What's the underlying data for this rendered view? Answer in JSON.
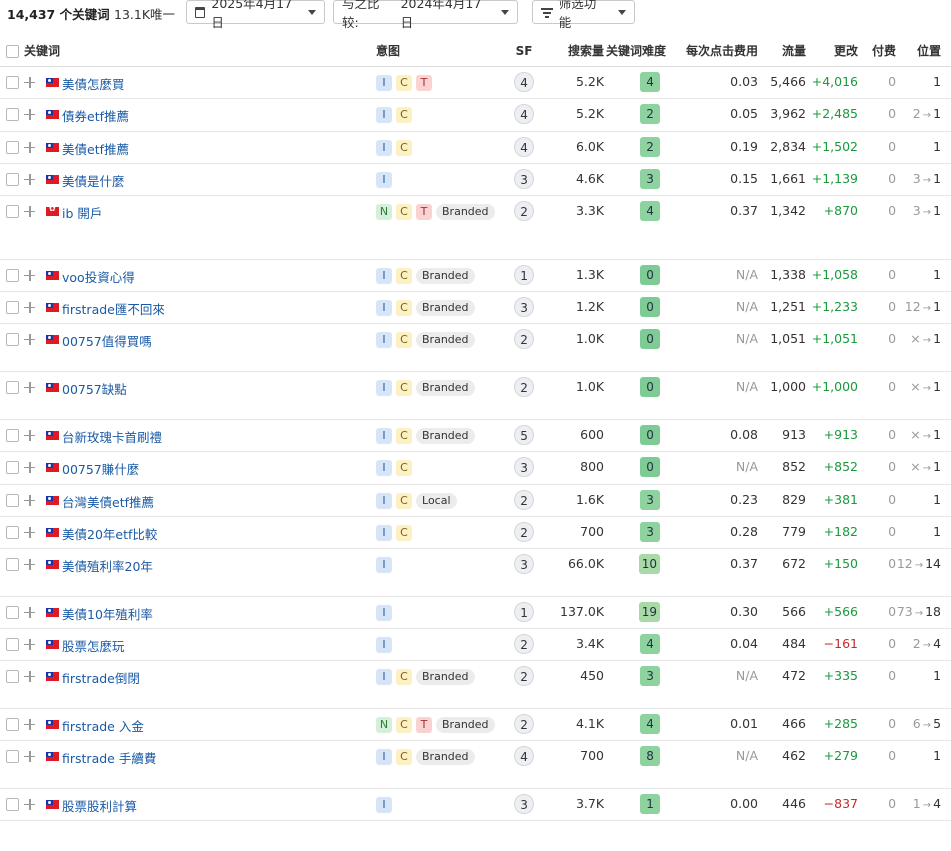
{
  "topbar": {
    "keyword_count": "14,437 个关键词",
    "unique": "13.1K唯一",
    "date": "2025年4月17日",
    "compare_label": "与之比较:",
    "compare_date": "2024年4月17日",
    "filter_label": "筛选功能"
  },
  "columns": {
    "keyword": "关键词",
    "intent": "意图",
    "sf": "SF",
    "volume": "搜索量",
    "kd": "关键词难度",
    "cpc": "每次点击费用",
    "traffic": "流量",
    "change": "更改",
    "paid": "付费",
    "position": "位置"
  },
  "rows": [
    {
      "flag": "tw",
      "keyword": "美債怎麼買",
      "intents": [
        "I",
        "C",
        "T"
      ],
      "tag": "",
      "sf": "4",
      "volume": "5.2K",
      "kd": "4",
      "cpc": "0.03",
      "traffic": "5,466",
      "change": "+4,016",
      "sign": "pos",
      "paid": "0",
      "pos_from": "",
      "pos_arrow": "",
      "pos_to": "1",
      "height": 32
    },
    {
      "flag": "tw",
      "keyword": "債券etf推薦",
      "intents": [
        "I",
        "C"
      ],
      "tag": "",
      "sf": "4",
      "volume": "5.2K",
      "kd": "2",
      "cpc": "0.05",
      "traffic": "3,962",
      "change": "+2,485",
      "sign": "pos",
      "paid": "0",
      "pos_from": "2",
      "pos_arrow": "→",
      "pos_to": "1",
      "height": 33
    },
    {
      "flag": "tw",
      "keyword": "美債etf推薦",
      "intents": [
        "I",
        "C"
      ],
      "tag": "",
      "sf": "4",
      "volume": "6.0K",
      "kd": "2",
      "cpc": "0.19",
      "traffic": "2,834",
      "change": "+1,502",
      "sign": "pos",
      "paid": "0",
      "pos_from": "",
      "pos_arrow": "",
      "pos_to": "1",
      "height": 32
    },
    {
      "flag": "tw",
      "keyword": "美債是什麼",
      "intents": [
        "I"
      ],
      "tag": "",
      "sf": "3",
      "volume": "4.6K",
      "kd": "3",
      "cpc": "0.15",
      "traffic": "1,661",
      "change": "+1,139",
      "sign": "pos",
      "paid": "0",
      "pos_from": "3",
      "pos_arrow": "→",
      "pos_to": "1",
      "height": 32
    },
    {
      "flag": "hk",
      "keyword": "ib 開戶",
      "intents": [
        "N",
        "C",
        "T"
      ],
      "tag": "Branded",
      "sf": "2",
      "volume": "3.3K",
      "kd": "4",
      "cpc": "0.37",
      "traffic": "1,342",
      "change": "+870",
      "sign": "pos",
      "paid": "0",
      "pos_from": "3",
      "pos_arrow": "→",
      "pos_to": "1",
      "height": 64
    },
    {
      "flag": "tw",
      "keyword": "voo投資心得",
      "intents": [
        "I",
        "C"
      ],
      "tag": "Branded",
      "sf": "1",
      "volume": "1.3K",
      "kd": "0",
      "cpc": "N/A",
      "traffic": "1,338",
      "change": "+1,058",
      "sign": "pos",
      "paid": "0",
      "pos_from": "",
      "pos_arrow": "",
      "pos_to": "1",
      "height": 32
    },
    {
      "flag": "tw",
      "keyword": "firstrade匯不回來",
      "intents": [
        "I",
        "C"
      ],
      "tag": "Branded",
      "sf": "3",
      "volume": "1.2K",
      "kd": "0",
      "cpc": "N/A",
      "traffic": "1,251",
      "change": "+1,233",
      "sign": "pos",
      "paid": "0",
      "pos_from": "12",
      "pos_arrow": "→",
      "pos_to": "1",
      "height": 32
    },
    {
      "flag": "tw",
      "keyword": "00757值得買嗎",
      "intents": [
        "I",
        "C"
      ],
      "tag": "Branded",
      "sf": "2",
      "volume": "1.0K",
      "kd": "0",
      "cpc": "N/A",
      "traffic": "1,051",
      "change": "+1,051",
      "sign": "pos",
      "paid": "0",
      "pos_from": "×",
      "pos_arrow": "→",
      "pos_to": "1",
      "height": 48
    },
    {
      "flag": "tw",
      "keyword": "00757缺點",
      "intents": [
        "I",
        "C"
      ],
      "tag": "Branded",
      "sf": "2",
      "volume": "1.0K",
      "kd": "0",
      "cpc": "N/A",
      "traffic": "1,000",
      "change": "+1,000",
      "sign": "pos",
      "paid": "0",
      "pos_from": "×",
      "pos_arrow": "→",
      "pos_to": "1",
      "height": 48
    },
    {
      "flag": "tw",
      "keyword": "台新玫瑰卡首刷禮",
      "intents": [
        "I",
        "C"
      ],
      "tag": "Branded",
      "sf": "5",
      "volume": "600",
      "kd": "0",
      "cpc": "0.08",
      "traffic": "913",
      "change": "+913",
      "sign": "pos",
      "paid": "0",
      "pos_from": "×",
      "pos_arrow": "→",
      "pos_to": "1",
      "height": 32
    },
    {
      "flag": "tw",
      "keyword": "00757賺什麼",
      "intents": [
        "I",
        "C"
      ],
      "tag": "",
      "sf": "3",
      "volume": "800",
      "kd": "0",
      "cpc": "N/A",
      "traffic": "852",
      "change": "+852",
      "sign": "pos",
      "paid": "0",
      "pos_from": "×",
      "pos_arrow": "→",
      "pos_to": "1",
      "height": 33
    },
    {
      "flag": "tw",
      "keyword": "台灣美債etf推薦",
      "intents": [
        "I",
        "C"
      ],
      "tag": "Local",
      "sf": "2",
      "volume": "1.6K",
      "kd": "3",
      "cpc": "0.23",
      "traffic": "829",
      "change": "+381",
      "sign": "pos",
      "paid": "0",
      "pos_from": "",
      "pos_arrow": "",
      "pos_to": "1",
      "height": 32
    },
    {
      "flag": "tw",
      "keyword": "美債20年etf比較",
      "intents": [
        "I",
        "C"
      ],
      "tag": "",
      "sf": "2",
      "volume": "700",
      "kd": "3",
      "cpc": "0.28",
      "traffic": "779",
      "change": "+182",
      "sign": "pos",
      "paid": "0",
      "pos_from": "",
      "pos_arrow": "",
      "pos_to": "1",
      "height": 32
    },
    {
      "flag": "tw",
      "keyword": "美債殖利率20年",
      "intents": [
        "I"
      ],
      "tag": "",
      "sf": "3",
      "volume": "66.0K",
      "kd": "10",
      "cpc": "0.37",
      "traffic": "672",
      "change": "+150",
      "sign": "pos",
      "paid": "0",
      "pos_from": "12",
      "pos_arrow": "→",
      "pos_to": "14",
      "height": 48
    },
    {
      "flag": "tw",
      "keyword": "美債10年殖利率",
      "intents": [
        "I"
      ],
      "tag": "",
      "sf": "1",
      "volume": "137.0K",
      "kd": "19",
      "cpc": "0.30",
      "traffic": "566",
      "change": "+566",
      "sign": "pos",
      "paid": "0",
      "pos_from": "73",
      "pos_arrow": "→",
      "pos_to": "18",
      "height": 32
    },
    {
      "flag": "tw",
      "keyword": "股票怎麼玩",
      "intents": [
        "I"
      ],
      "tag": "",
      "sf": "2",
      "volume": "3.4K",
      "kd": "4",
      "cpc": "0.04",
      "traffic": "484",
      "change": "−161",
      "sign": "neg",
      "paid": "0",
      "pos_from": "2",
      "pos_arrow": "→",
      "pos_to": "4",
      "height": 32
    },
    {
      "flag": "tw",
      "keyword": "firstrade倒閉",
      "intents": [
        "I",
        "C"
      ],
      "tag": "Branded",
      "sf": "2",
      "volume": "450",
      "kd": "3",
      "cpc": "N/A",
      "traffic": "472",
      "change": "+335",
      "sign": "pos",
      "paid": "0",
      "pos_from": "",
      "pos_arrow": "",
      "pos_to": "1",
      "height": 48
    },
    {
      "flag": "tw",
      "keyword": "firstrade 入金",
      "intents": [
        "N",
        "C",
        "T"
      ],
      "tag": "Branded",
      "sf": "2",
      "volume": "4.1K",
      "kd": "4",
      "cpc": "0.01",
      "traffic": "466",
      "change": "+285",
      "sign": "pos",
      "paid": "0",
      "pos_from": "6",
      "pos_arrow": "→",
      "pos_to": "5",
      "height": 32
    },
    {
      "flag": "tw",
      "keyword": "firstrade 手續費",
      "intents": [
        "I",
        "C"
      ],
      "tag": "Branded",
      "sf": "4",
      "volume": "700",
      "kd": "8",
      "cpc": "N/A",
      "traffic": "462",
      "change": "+279",
      "sign": "pos",
      "paid": "0",
      "pos_from": "",
      "pos_arrow": "",
      "pos_to": "1",
      "height": 48
    },
    {
      "flag": "tw",
      "keyword": "股票股利計算",
      "intents": [
        "I"
      ],
      "tag": "",
      "sf": "3",
      "volume": "3.7K",
      "kd": "1",
      "cpc": "0.00",
      "traffic": "446",
      "change": "−837",
      "sign": "neg",
      "paid": "0",
      "pos_from": "1",
      "pos_arrow": "→",
      "pos_to": "4",
      "height": 32
    }
  ]
}
